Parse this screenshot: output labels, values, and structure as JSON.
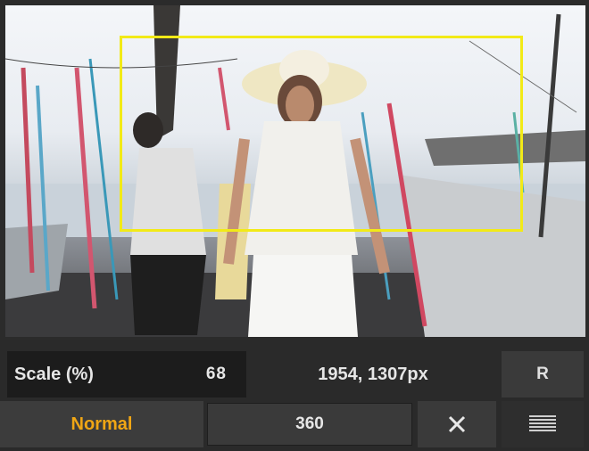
{
  "preview": {
    "description_icon": "photo-preview"
  },
  "scale": {
    "label": "Scale (%)",
    "value": "68"
  },
  "dimensions": "1954, 1307px",
  "reset_button": "R",
  "mode": {
    "label": "Normal",
    "color": "#f0a614"
  },
  "size_field": "360",
  "icons": {
    "close": "close-icon",
    "menu": "menu-lines-icon"
  },
  "colors": {
    "crop_box": "#f2ea17",
    "panel": "#2a2a2a",
    "accent": "#f0a614"
  }
}
